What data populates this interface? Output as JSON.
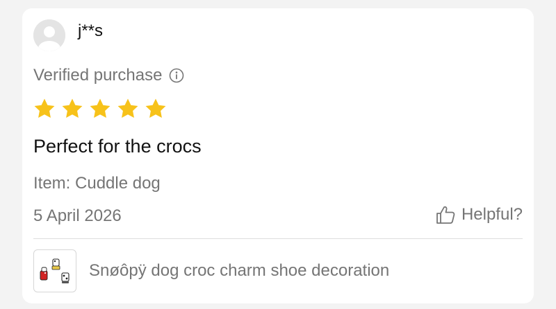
{
  "review": {
    "username": "j**s",
    "verified_label": "Verified purchase",
    "rating": 5,
    "rating_max": 5,
    "title": "Perfect for the crocs",
    "item_line": "Item: Cuddle dog",
    "date": "5 April 2026",
    "helpful_label": "Helpful?"
  },
  "product": {
    "name": "Snøôpÿ dog croc charm shoe decoration"
  },
  "icons": {
    "avatar": "default-avatar-icon",
    "info": "info-icon",
    "star": "star-icon",
    "helpful": "thumbs-up-icon"
  },
  "colors": {
    "star": "#F7C21A",
    "muted_text": "#757575",
    "primary_text": "#111111"
  }
}
